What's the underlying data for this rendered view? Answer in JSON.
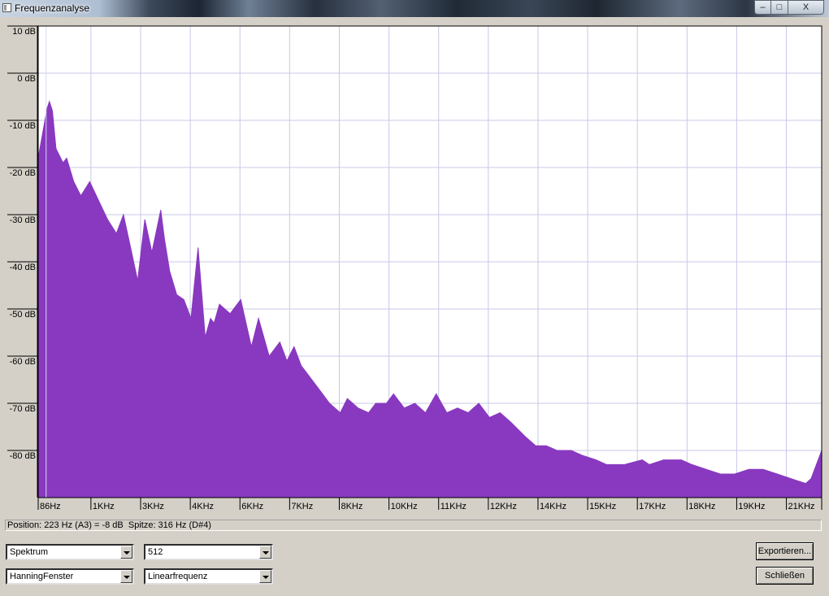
{
  "window": {
    "title": "Frequenzanalyse",
    "buttons": {
      "minimize": "‒",
      "maximize": "□",
      "close": "X"
    }
  },
  "chart_data": {
    "type": "area",
    "title": "",
    "xlabel": "",
    "ylabel": "",
    "ylim": [
      -90,
      10
    ],
    "xlim": [
      0,
      22050
    ],
    "grid": true,
    "fill_color": "#8939c0",
    "cursor_hz": 223,
    "y_ticks": [
      10,
      0,
      -10,
      -20,
      -30,
      -40,
      -50,
      -60,
      -70,
      -80
    ],
    "y_tick_labels": [
      "10 dB",
      "0 dB",
      "-10 dB",
      "-20 dB",
      "-30 dB",
      "-40 dB",
      "-50 dB",
      "-60 dB",
      "-70 dB",
      "-80 dB"
    ],
    "x_ticks": [
      86,
      1484,
      2882,
      4280,
      5678,
      7076,
      8474,
      9872,
      11270,
      12668,
      14066,
      15464,
      16862,
      18260,
      19658,
      21056
    ],
    "x_tick_labels": [
      "86Hz",
      "1KHz",
      "3KHz",
      "4KHz",
      "6KHz",
      "7KHz",
      "8KHz",
      "10KHz",
      "11KHz",
      "12KHz",
      "14KHz",
      "15KHz",
      "17KHz",
      "18KHz",
      "19KHz",
      "21KHz"
    ],
    "x": [
      0,
      120,
      250,
      316,
      400,
      500,
      700,
      800,
      1000,
      1200,
      1450,
      1700,
      1950,
      2200,
      2400,
      2600,
      2800,
      3000,
      3200,
      3450,
      3550,
      3700,
      3900,
      4100,
      4300,
      4500,
      4700,
      4850,
      4950,
      5100,
      5400,
      5700,
      6000,
      6200,
      6500,
      6800,
      7000,
      7200,
      7400,
      7600,
      7900,
      8200,
      8500,
      8700,
      9000,
      9300,
      9500,
      9800,
      10000,
      10300,
      10600,
      10900,
      11200,
      11500,
      11800,
      12100,
      12400,
      12700,
      13000,
      13300,
      13700,
      14000,
      14300,
      14600,
      15000,
      15300,
      15700,
      16000,
      16500,
      17000,
      17200,
      17600,
      18100,
      18400,
      18800,
      19200,
      19600,
      20000,
      20400,
      20800,
      21200,
      21600,
      21750,
      22050
    ],
    "values": [
      -18,
      -13,
      -7.5,
      -6,
      -8,
      -16,
      -19,
      -18,
      -23,
      -26,
      -23,
      -27,
      -31,
      -34,
      -30,
      -37,
      -44,
      -31,
      -38,
      -29,
      -35,
      -42,
      -47,
      -48,
      -52,
      -37,
      -56,
      -52,
      -53,
      -49,
      -51,
      -48,
      -58,
      -52,
      -60,
      -57,
      -61,
      -58,
      -62,
      -64,
      -67,
      -70,
      -72,
      -69,
      -71,
      -72,
      -70,
      -70,
      -68,
      -71,
      -70,
      -72,
      -68,
      -72,
      -71,
      -72,
      -70,
      -73,
      -72,
      -74,
      -77,
      -79,
      -79,
      -80,
      -80,
      -81,
      -82,
      -83,
      -83,
      -82,
      -83,
      -82,
      -82,
      -83,
      -84,
      -85,
      -85,
      -84,
      -84,
      -85,
      -86,
      -87,
      -86,
      -80
    ]
  },
  "status": {
    "text": "Position: 223 Hz (A3) = -8 dB  Spitze: 316 Hz (D#4)"
  },
  "controls": {
    "algorithm": "Spektrum",
    "size": "512",
    "window_func": "HanningFenster",
    "axis": "Linearfrequenz",
    "export_label": "Exportieren...",
    "close_label": "Schließen"
  }
}
